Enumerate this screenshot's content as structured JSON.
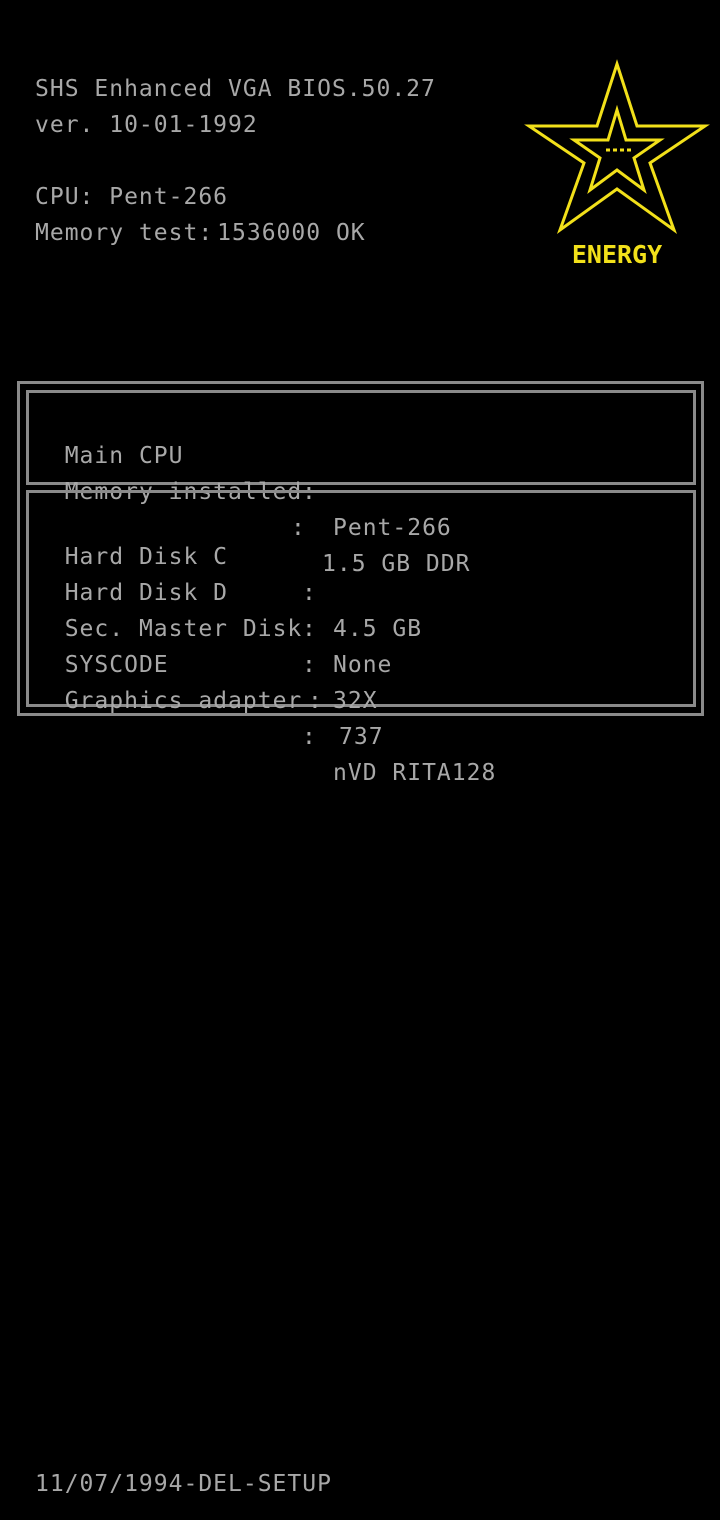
{
  "header": {
    "bios_name": "SHS Enhanced VGA BIOS.50.27",
    "version": "ver. 10-01-1992",
    "cpu_line": "CPU: Pent-266",
    "memory_test_label": "Memory test:",
    "memory_test_value": "1536000 OK"
  },
  "logo": {
    "text": "ENERGY",
    "color": "#f2e01a"
  },
  "cpu_box": {
    "rows": [
      {
        "label": "Main CPU",
        "sep": ":",
        "value": "Pent-266"
      },
      {
        "label": "Memory installed",
        "sep": ":",
        "value": "1.5 GB DDR"
      }
    ]
  },
  "disk_box": {
    "rows": [
      {
        "label": "Hard Disk C",
        "sep": ":",
        "value": "4.5 GB"
      },
      {
        "label": "Hard Disk D",
        "sep": ":",
        "value": "None"
      },
      {
        "label": "Sec. Master Disk",
        "sep": ":",
        "value": "32X"
      },
      {
        "label": "SYSCODE",
        "sep": ":",
        "value": "737"
      },
      {
        "label": "Graphics adapter",
        "sep": ":",
        "value": "nVD RITA128"
      }
    ]
  },
  "footer": {
    "text": "11/07/1994-DEL-SETUP"
  },
  "colors": {
    "text": "#a8a8a8",
    "background": "#000000",
    "border": "#8a8a8a",
    "logo": "#f2e01a"
  }
}
